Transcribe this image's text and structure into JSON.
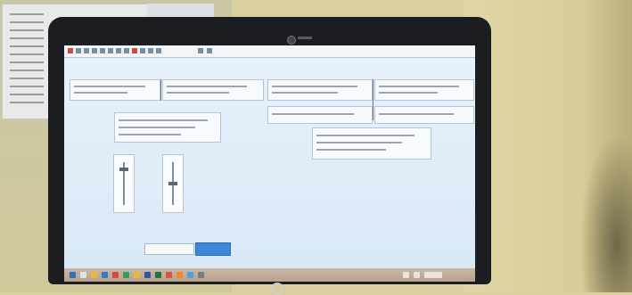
{
  "scene": {
    "description_colors": {
      "wall": "#d9cf9c",
      "laptop_bezel": "#1c1d21",
      "screen_bg": "#e2eef9",
      "accent_button": "#3f86d6",
      "taskbar": "#c0a996"
    },
    "laptop_brand_icon": "hp-logo-icon"
  },
  "screen": {
    "toolbar_icons": [
      "app-icon",
      "back-icon",
      "forward-icon",
      "save-icon",
      "print-icon",
      "copy-icon",
      "paste-icon",
      "undo-icon",
      "redo-icon",
      "stop-icon",
      "refresh-icon",
      "home-icon",
      "settings-icon",
      "help-icon"
    ],
    "left_section_title": "",
    "right_section_title": "",
    "submit_label": "",
    "input_value": "",
    "taskbar_icons": [
      "start-icon",
      "search-icon",
      "file-explorer-icon",
      "browser-icon",
      "mail-icon",
      "store-icon",
      "folder-icon",
      "word-icon",
      "excel-icon",
      "chrome-icon",
      "media-icon",
      "photos-icon",
      "settings-icon",
      "network-icon",
      "volume-icon",
      "clock-icon"
    ]
  }
}
